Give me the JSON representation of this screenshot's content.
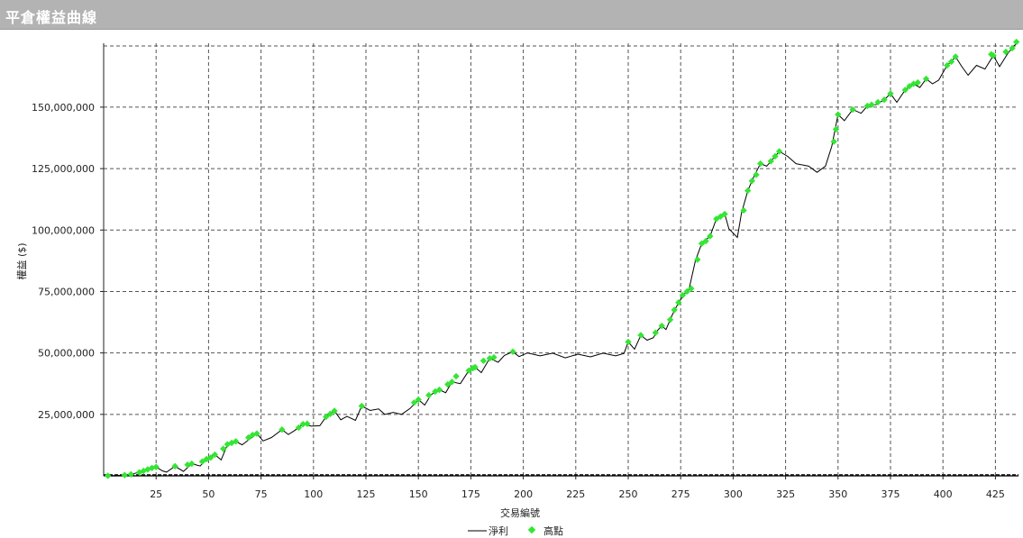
{
  "window": {
    "title": "平倉權益曲線"
  },
  "chart_data": {
    "type": "line",
    "xlabel": "交易編號",
    "ylabel": "權益 ($)",
    "xlim": [
      0,
      436
    ],
    "ylim": [
      0,
      176000000
    ],
    "xticks": [
      25,
      50,
      75,
      100,
      125,
      150,
      175,
      200,
      225,
      250,
      275,
      300,
      325,
      350,
      375,
      400,
      425
    ],
    "yticks": [
      25000000,
      50000000,
      75000000,
      100000000,
      125000000,
      150000000
    ],
    "ytick_labels": [
      "25,000,000",
      "50,000,000",
      "75,000,000",
      "100,000,000",
      "125,000,000",
      "150,000,000"
    ],
    "grid": true,
    "legend_position": "bottom-center",
    "series": [
      {
        "name": "淨利",
        "style": "line",
        "color": "#000000",
        "points": [
          [
            2,
            0
          ],
          [
            8,
            200000
          ],
          [
            14,
            800000
          ],
          [
            20,
            2200000
          ],
          [
            25,
            3600000
          ],
          [
            28,
            2000000
          ],
          [
            30,
            1500000
          ],
          [
            34,
            3900000
          ],
          [
            38,
            1800000
          ],
          [
            42,
            4900000
          ],
          [
            46,
            4000000
          ],
          [
            49,
            6800000
          ],
          [
            53,
            8600000
          ],
          [
            56,
            6500000
          ],
          [
            59,
            12800000
          ],
          [
            63,
            14000000
          ],
          [
            66,
            12600000
          ],
          [
            70,
            15200000
          ],
          [
            73,
            17200000
          ],
          [
            76,
            14200000
          ],
          [
            80,
            15600000
          ],
          [
            85,
            18800000
          ],
          [
            88,
            16800000
          ],
          [
            91,
            18400000
          ],
          [
            95,
            21000000
          ],
          [
            99,
            20200000
          ],
          [
            103,
            20400000
          ],
          [
            106,
            24000000
          ],
          [
            110,
            26400000
          ],
          [
            113,
            22800000
          ],
          [
            116,
            24200000
          ],
          [
            120,
            22600000
          ],
          [
            123,
            28400000
          ],
          [
            127,
            26600000
          ],
          [
            131,
            27200000
          ],
          [
            134,
            25000000
          ],
          [
            138,
            25800000
          ],
          [
            142,
            25000000
          ],
          [
            146,
            27400000
          ],
          [
            150,
            31000000
          ],
          [
            153,
            28800000
          ],
          [
            156,
            33000000
          ],
          [
            160,
            35000000
          ],
          [
            163,
            33800000
          ],
          [
            166,
            38200000
          ],
          [
            170,
            37500000
          ],
          [
            174,
            42800000
          ],
          [
            177,
            44200000
          ],
          [
            180,
            42000000
          ],
          [
            184,
            47800000
          ],
          [
            188,
            46200000
          ],
          [
            191,
            49000000
          ],
          [
            195,
            50500000
          ],
          [
            198,
            48500000
          ],
          [
            202,
            50000000
          ],
          [
            208,
            48800000
          ],
          [
            214,
            49900000
          ],
          [
            220,
            48000000
          ],
          [
            226,
            49500000
          ],
          [
            232,
            48400000
          ],
          [
            238,
            49900000
          ],
          [
            244,
            48800000
          ],
          [
            248,
            49800000
          ],
          [
            250,
            54500000
          ],
          [
            253,
            51500000
          ],
          [
            256,
            57200000
          ],
          [
            259,
            55200000
          ],
          [
            262,
            56200000
          ],
          [
            264,
            59200000
          ],
          [
            266,
            61000000
          ],
          [
            268,
            59500000
          ],
          [
            271,
            65500000
          ],
          [
            274,
            70500000
          ],
          [
            277,
            74200000
          ],
          [
            279,
            76000000
          ],
          [
            282,
            87500000
          ],
          [
            285,
            94500000
          ],
          [
            289,
            97500000
          ],
          [
            292,
            104500000
          ],
          [
            296,
            106500000
          ],
          [
            298,
            100500000
          ],
          [
            302,
            97000000
          ],
          [
            304,
            107000000
          ],
          [
            307,
            116000000
          ],
          [
            310,
            122000000
          ],
          [
            313,
            127000000
          ],
          [
            316,
            126000000
          ],
          [
            318,
            128000000
          ],
          [
            322,
            132000000
          ],
          [
            326,
            130000000
          ],
          [
            330,
            127000000
          ],
          [
            336,
            126000000
          ],
          [
            340,
            123500000
          ],
          [
            344,
            126000000
          ],
          [
            347,
            134000000
          ],
          [
            350,
            147000000
          ],
          [
            353,
            144500000
          ],
          [
            357,
            149000000
          ],
          [
            361,
            147500000
          ],
          [
            364,
            150500000
          ],
          [
            368,
            151000000
          ],
          [
            372,
            153000000
          ],
          [
            375,
            155500000
          ],
          [
            378,
            152000000
          ],
          [
            382,
            157000000
          ],
          [
            386,
            159500000
          ],
          [
            389,
            158000000
          ],
          [
            392,
            161500000
          ],
          [
            395,
            159500000
          ],
          [
            398,
            161000000
          ],
          [
            402,
            167000000
          ],
          [
            406,
            170500000
          ],
          [
            409,
            166500000
          ],
          [
            412,
            163000000
          ],
          [
            416,
            167000000
          ],
          [
            420,
            165500000
          ],
          [
            424,
            171000000
          ],
          [
            427,
            166500000
          ],
          [
            431,
            172000000
          ],
          [
            434,
            175000000
          ],
          [
            436,
            177000000
          ]
        ]
      },
      {
        "name": "高點",
        "style": "markers",
        "color": "#33e633",
        "points": [
          [
            2,
            0
          ],
          [
            10,
            300000
          ],
          [
            13,
            600000
          ],
          [
            17,
            1400000
          ],
          [
            19,
            2000000
          ],
          [
            21,
            2600000
          ],
          [
            23,
            3200000
          ],
          [
            25,
            3600000
          ],
          [
            34,
            3900000
          ],
          [
            40,
            4500000
          ],
          [
            42,
            4900000
          ],
          [
            47,
            5800000
          ],
          [
            49,
            6800000
          ],
          [
            51,
            7400000
          ],
          [
            53,
            8600000
          ],
          [
            57,
            11000000
          ],
          [
            59,
            12800000
          ],
          [
            61,
            13400000
          ],
          [
            63,
            14000000
          ],
          [
            69,
            15600000
          ],
          [
            71,
            16600000
          ],
          [
            73,
            17200000
          ],
          [
            85,
            18800000
          ],
          [
            93,
            19600000
          ],
          [
            95,
            21000000
          ],
          [
            97,
            21200000
          ],
          [
            106,
            24000000
          ],
          [
            108,
            25200000
          ],
          [
            110,
            26400000
          ],
          [
            123,
            28400000
          ],
          [
            148,
            29800000
          ],
          [
            150,
            31000000
          ],
          [
            155,
            32800000
          ],
          [
            158,
            34300000
          ],
          [
            160,
            35000000
          ],
          [
            164,
            37200000
          ],
          [
            166,
            38200000
          ],
          [
            168,
            40500000
          ],
          [
            174,
            42800000
          ],
          [
            176,
            43800000
          ],
          [
            177,
            44200000
          ],
          [
            181,
            46800000
          ],
          [
            184,
            47800000
          ],
          [
            186,
            48200000
          ],
          [
            195,
            50500000
          ],
          [
            250,
            54500000
          ],
          [
            256,
            57200000
          ],
          [
            263,
            58200000
          ],
          [
            266,
            61000000
          ],
          [
            270,
            63500000
          ],
          [
            272,
            67500000
          ],
          [
            274,
            70500000
          ],
          [
            276,
            73500000
          ],
          [
            278,
            75000000
          ],
          [
            280,
            76200000
          ],
          [
            283,
            88000000
          ],
          [
            285,
            94500000
          ],
          [
            287,
            95500000
          ],
          [
            289,
            97500000
          ],
          [
            292,
            104500000
          ],
          [
            294,
            105500000
          ],
          [
            296,
            106500000
          ],
          [
            305,
            108000000
          ],
          [
            307,
            116000000
          ],
          [
            309,
            120000000
          ],
          [
            311,
            122500000
          ],
          [
            313,
            127000000
          ],
          [
            318,
            128000000
          ],
          [
            320,
            130000000
          ],
          [
            322,
            132000000
          ],
          [
            348,
            136000000
          ],
          [
            349,
            141000000
          ],
          [
            350,
            147000000
          ],
          [
            357,
            149000000
          ],
          [
            364,
            150500000
          ],
          [
            366,
            151000000
          ],
          [
            369,
            152000000
          ],
          [
            372,
            153000000
          ],
          [
            375,
            155500000
          ],
          [
            382,
            157000000
          ],
          [
            384,
            158500000
          ],
          [
            386,
            159500000
          ],
          [
            388,
            160000000
          ],
          [
            392,
            161500000
          ],
          [
            402,
            167000000
          ],
          [
            404,
            168500000
          ],
          [
            406,
            170500000
          ],
          [
            423,
            171500000
          ],
          [
            424,
            171000000
          ],
          [
            430,
            172500000
          ],
          [
            433,
            174000000
          ],
          [
            435,
            176500000
          ]
        ]
      }
    ]
  }
}
